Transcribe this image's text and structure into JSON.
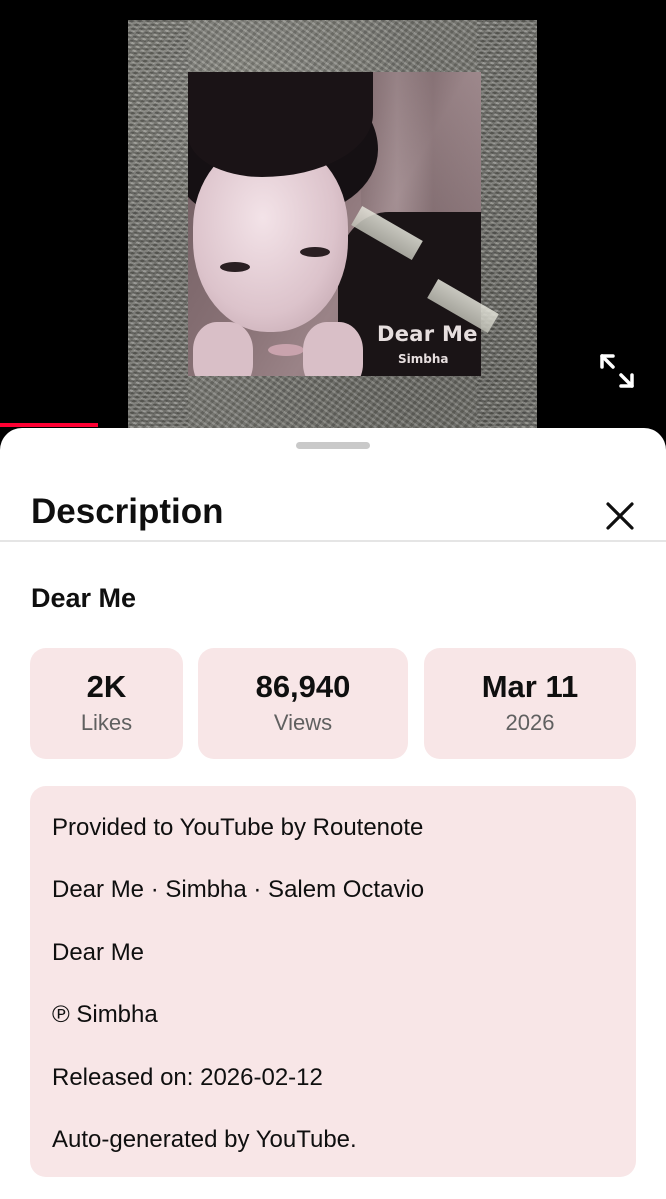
{
  "video": {
    "cover_title": "Dear Me",
    "cover_artist": "Simbha",
    "progress_fraction": 0.147,
    "accent_color": "#ff0033"
  },
  "sheet": {
    "title": "Description",
    "close_icon": "close-icon"
  },
  "details": {
    "video_title": "Dear Me",
    "stats": {
      "likes": {
        "value": "2K",
        "label": "Likes"
      },
      "views": {
        "value": "86,940",
        "label": "Views"
      },
      "date": {
        "value": "Mar 11",
        "label": "2026"
      }
    },
    "description_lines": [
      "Provided to YouTube by Routenote",
      "Dear Me · Simbha · Salem Octavio",
      "Dear Me",
      "℗ Simbha",
      "Released on: 2026-02-12",
      "Auto-generated by YouTube."
    ]
  },
  "colors": {
    "stat_background": "#f8e6e7",
    "text_primary": "#0f0f0f",
    "text_secondary": "#606060"
  }
}
